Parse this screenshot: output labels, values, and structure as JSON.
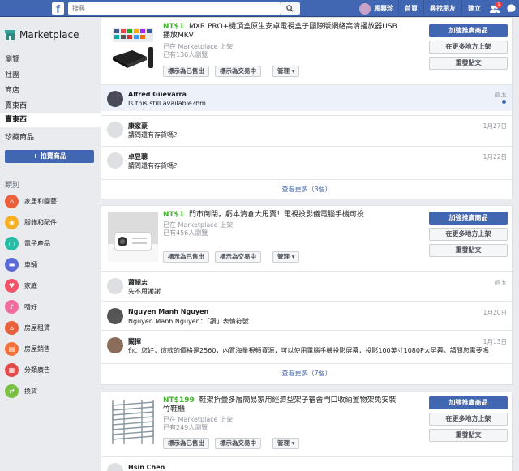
{
  "topbar": {
    "search_placeholder": "搜尋",
    "user_name": "馬興珍",
    "nav": [
      "首頁",
      "尋找朋友",
      "建立"
    ],
    "badge_count": "1"
  },
  "sidebar": {
    "title": "Marketplace",
    "items": [
      "瀏覽",
      "社團",
      "商店",
      "賣東西",
      "賣東西",
      "珍藏商品"
    ],
    "sell_button": "+ 拍賣商品",
    "categories_header": "類別",
    "categories": [
      {
        "label": "家居和園藝",
        "color": "#e9603a"
      },
      {
        "label": "服飾和配件",
        "color": "#f5b025"
      },
      {
        "label": "電子產品",
        "color": "#2abba7"
      },
      {
        "label": "車輛",
        "color": "#5b6bd6"
      },
      {
        "label": "家庭",
        "color": "#f35369"
      },
      {
        "label": "嗜好",
        "color": "#f26c9f"
      },
      {
        "label": "房屋租賃",
        "color": "#e9603a"
      },
      {
        "label": "房屋銷售",
        "color": "#f5713b"
      },
      {
        "label": "分類廣告",
        "color": "#e34a4a"
      },
      {
        "label": "換貨",
        "color": "#7ac143"
      }
    ]
  },
  "listings": [
    {
      "price": "NT$1",
      "title": "MXR PRO+機頂盒原生安卓電視盒子國際版網絡高清播放器USB播放MKV",
      "meta1": "已在 Marketplace 上架",
      "meta2": "已有136人瀏覽",
      "btn_sold": "標示為已售出",
      "btn_pending": "標示為交易中",
      "btn_manage": "管理 ▾",
      "boost": "加強推廣商品",
      "more_places": "在更多地方上架",
      "renew": "重發貼文",
      "messages": [
        {
          "name": "Alfred Guevarra",
          "text": "Is this still available?hm",
          "time": "週五",
          "unread": true
        },
        {
          "name": "康家豪",
          "text": "請問還有存貨嗎？",
          "time": "1月27日",
          "unread": false
        },
        {
          "name": "卓昱聰",
          "text": "請問還有存貨嗎？",
          "time": "1月22日",
          "unread": false
        }
      ],
      "see_more": "查看更多（3個）"
    },
    {
      "price": "NT$1",
      "title": "門市倒閉，虧本清倉大甩賣！電視投影儀電腦手機可投",
      "meta1": "已在 Marketplace 上架",
      "meta2": "已有456人瀏覽",
      "btn_sold": "標示為已售出",
      "btn_pending": "標示為交易中",
      "btn_manage": "管理 ▾",
      "boost": "加強推廣商品",
      "more_places": "在更多地方上架",
      "renew": "重發貼文",
      "messages": [
        {
          "name": "蕭韶志",
          "text": "先不用謝謝",
          "time": "週五",
          "unread": false
        },
        {
          "name": "Nguyen Manh Nguyen",
          "text": "Nguyen Manh Nguyen：「讚」表情符號",
          "time": "1月20日",
          "unread": false
        },
        {
          "name": "闞揮",
          "text": "你：您好，這款的價格是2560，內置海量視頻資源，可以使用電腦手機投影屏幕，投影100英寸1080P大屏幕，請問您需要嗎",
          "time": "1月13日",
          "unread": false
        }
      ],
      "see_more": "查看更多（7個）"
    },
    {
      "price": "NT$199",
      "title": "鞋架折疊多層簡易家用經濟型架子宿舍門口收納置物架免安裝竹鞋櫃",
      "meta1": "已在 Marketplace 上架",
      "meta2": "已有249人瀏覽",
      "btn_sold": "標示為已售出",
      "btn_pending": "標示為交易中",
      "btn_manage": "管理 ▾",
      "boost": "加強推廣商品",
      "more_places": "在更多地方上架",
      "renew": "重發貼文",
      "messages": [
        {
          "name": "Hsin Chen",
          "text": "",
          "time": "",
          "unread": false
        }
      ]
    }
  ]
}
